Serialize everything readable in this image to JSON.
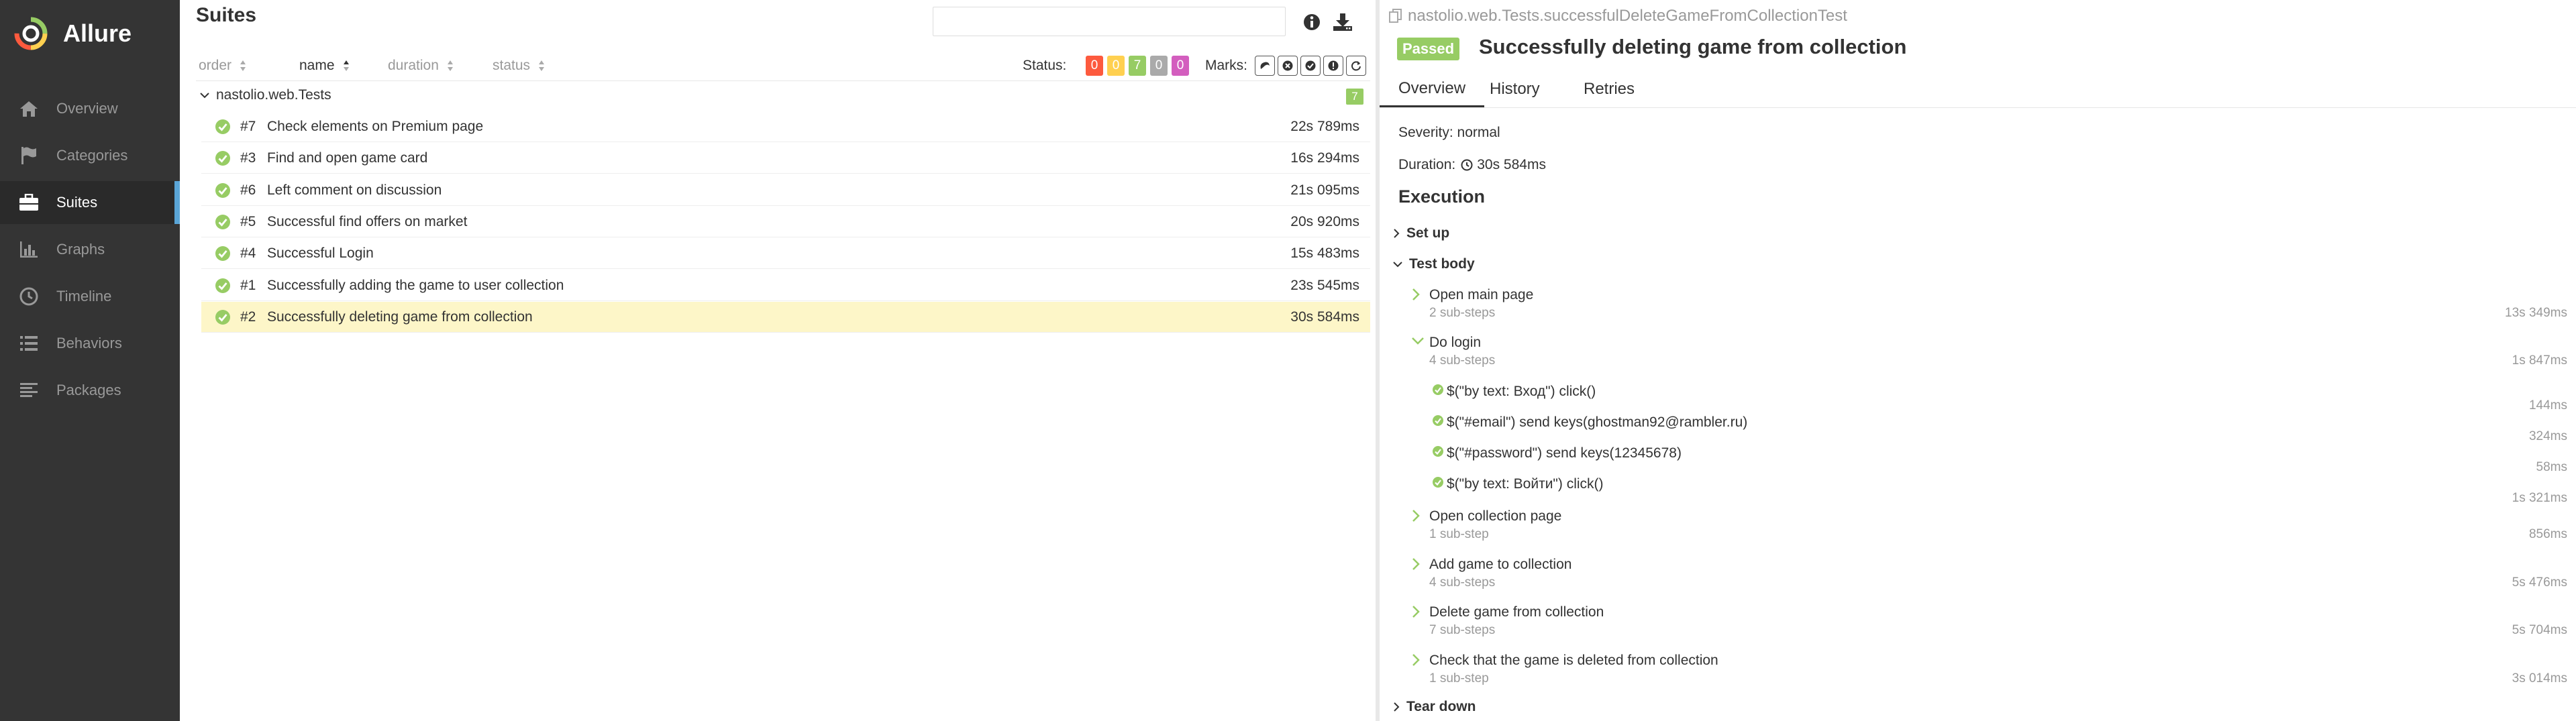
{
  "sidebar": {
    "brand": "Allure",
    "items": [
      {
        "label": "Overview",
        "icon": "home-icon"
      },
      {
        "label": "Categories",
        "icon": "flag-icon"
      },
      {
        "label": "Suites",
        "icon": "briefcase-icon",
        "active": true
      },
      {
        "label": "Graphs",
        "icon": "bar-chart-icon"
      },
      {
        "label": "Timeline",
        "icon": "clock-icon"
      },
      {
        "label": "Behaviors",
        "icon": "list-icon"
      },
      {
        "label": "Packages",
        "icon": "align-left-icon"
      }
    ]
  },
  "suites": {
    "title": "Suites",
    "search_placeholder": "",
    "sort_headers": [
      "order",
      "name",
      "duration",
      "status"
    ],
    "status_label": "Status:",
    "status_counts": [
      {
        "value": "0",
        "color": "#fd5a3e"
      },
      {
        "value": "0",
        "color": "#ffd050"
      },
      {
        "value": "7",
        "color": "#97cc64"
      },
      {
        "value": "0",
        "color": "#aaaaaa"
      },
      {
        "value": "0",
        "color": "#d35ebe"
      }
    ],
    "marks_label": "Marks:",
    "group": {
      "name": "nastolio.web.Tests",
      "count": "7"
    },
    "tests": [
      {
        "num": "#7",
        "name": "Check elements on Premium page",
        "duration": "22s 789ms"
      },
      {
        "num": "#3",
        "name": "Find and open game card",
        "duration": "16s 294ms"
      },
      {
        "num": "#6",
        "name": "Left comment on discussion",
        "duration": "21s 095ms"
      },
      {
        "num": "#5",
        "name": "Successful find offers on market",
        "duration": "20s 920ms"
      },
      {
        "num": "#4",
        "name": "Successful Login",
        "duration": "15s 483ms"
      },
      {
        "num": "#1",
        "name": "Successfully adding the game to user collection",
        "duration": "23s 545ms"
      },
      {
        "num": "#2",
        "name": "Successfully deleting game from collection",
        "duration": "30s 584ms",
        "selected": true
      }
    ]
  },
  "detail": {
    "path": "nastolio.web.Tests.successfulDeleteGameFromCollectionTest",
    "status": "Passed",
    "title": "Successfully deleting game from collection",
    "tabs": [
      "Overview",
      "History",
      "Retries"
    ],
    "severity": "Severity: normal",
    "duration_label": "Duration:",
    "duration": "30s 584ms",
    "execution": "Execution",
    "setup": "Set up",
    "test_body": "Test body",
    "teardown": "Tear down",
    "steps": [
      {
        "name": "Open main page",
        "sub": "2 sub-steps",
        "duration": "13s 349ms"
      },
      {
        "name": "Do login",
        "sub": "4 sub-steps",
        "duration": "1s 847ms",
        "expanded": true
      },
      {
        "name": "Open collection page",
        "sub": "1 sub-step",
        "duration": "856ms"
      },
      {
        "name": "Add game to collection",
        "sub": "4 sub-steps",
        "duration": "5s 476ms"
      },
      {
        "name": "Delete game from collection",
        "sub": "7 sub-steps",
        "duration": "5s 704ms"
      },
      {
        "name": "Check that the game is deleted from collection",
        "sub": "1 sub-step",
        "duration": "3s 014ms"
      }
    ],
    "login_substeps": [
      {
        "name": "$(\"by text: Вход\") click()",
        "duration": "144ms"
      },
      {
        "name": "$(\"#email\") send keys(ghostman92@rambler.ru)",
        "duration": "324ms"
      },
      {
        "name": "$(\"#password\") send keys(12345678)",
        "duration": "58ms"
      },
      {
        "name": "$(\"by text: Войти\") click()",
        "duration": "1s 321ms"
      }
    ]
  }
}
